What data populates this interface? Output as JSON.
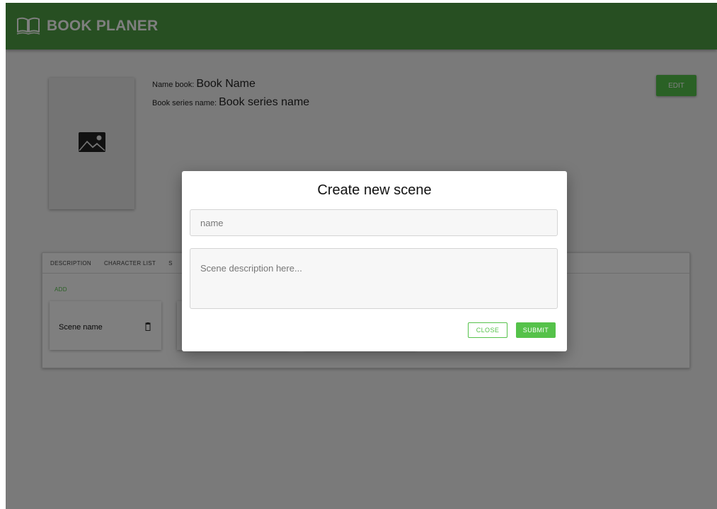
{
  "appbar": {
    "logo_icon": "open-book-icon",
    "title": "BOOK PLANER"
  },
  "book": {
    "cover_icon": "image-placeholder-icon",
    "name_label": "Name book:",
    "name_value": "Book Name",
    "series_label": "Book series name:",
    "series_value": "Book series name",
    "edit_label": "EDIT"
  },
  "tabs": {
    "items": [
      {
        "label": "DESCRIPTION"
      },
      {
        "label": "CHARACTER LIST"
      },
      {
        "label": "S"
      }
    ],
    "add_label": "ADD",
    "scenes": [
      {
        "name": "Scene name",
        "delete_icon": "trash-icon"
      }
    ]
  },
  "modal": {
    "title": "Create new scene",
    "name_placeholder": "name",
    "description_placeholder": "Scene description here...",
    "close_label": "CLOSE",
    "submit_label": "SUBMIT"
  },
  "colors": {
    "appbar": "#4e9f45",
    "accent": "#55c24a",
    "overlay": "rgba(0,0,0,0.5)"
  }
}
